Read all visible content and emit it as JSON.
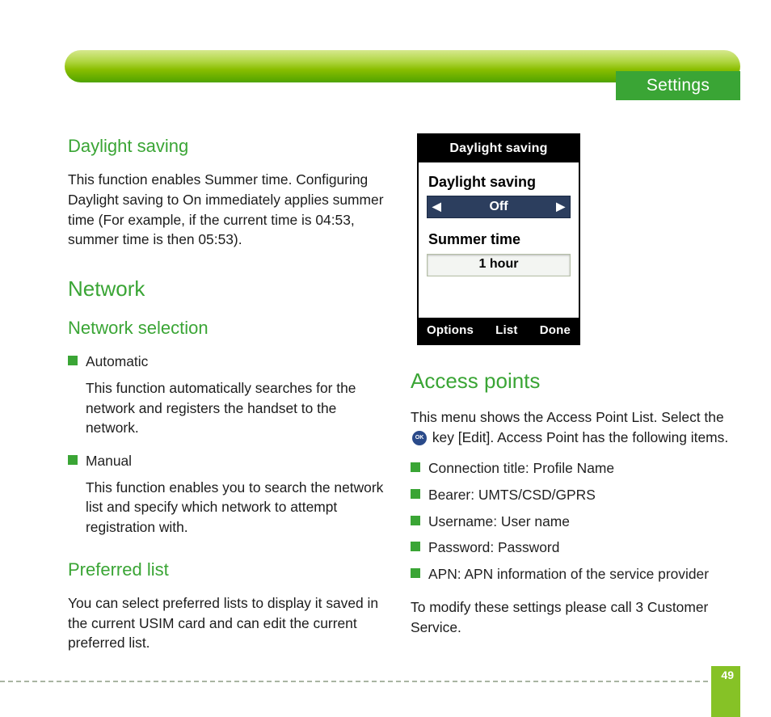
{
  "header": {
    "tab": "Settings"
  },
  "left": {
    "daylight": {
      "title": "Daylight saving",
      "body": "This function enables Summer time. Configuring Daylight saving to On immediately applies summer time (For example, if the current time is 04:53, summer time is then 05:53)."
    },
    "network": {
      "title": "Network",
      "selection": {
        "title": "Network selection",
        "auto_label": "Automatic",
        "auto_body": "This function automatically searches for the network and registers the handset to the network.",
        "manual_label": "Manual",
        "manual_body": "This function enables you to search the network list and specify which network to attempt registration with."
      },
      "preferred": {
        "title": "Preferred list",
        "body": "You can select preferred lists to display it saved in the current USIM card and can edit the current preferred list."
      }
    }
  },
  "right": {
    "access": {
      "title": "Access points",
      "intro_a": "This menu shows the Access Point List. Select the",
      "intro_b": "key [Edit]. Access Point has the following items.",
      "items": [
        "Connection title: Profile Name",
        "Bearer: UMTS/CSD/GPRS",
        "Username: User name",
        "Password: Password",
        "APN: APN information of the service provider"
      ],
      "outro": "To modify these settings please call 3 Customer Service."
    }
  },
  "phone": {
    "title": "Daylight saving",
    "label1": "Daylight saving",
    "value1": "Off",
    "label2": "Summer time",
    "value2": "1 hour",
    "sk_left": "Options",
    "sk_mid": "List",
    "sk_right": "Done"
  },
  "page_number": "49",
  "ok_label": "OK"
}
